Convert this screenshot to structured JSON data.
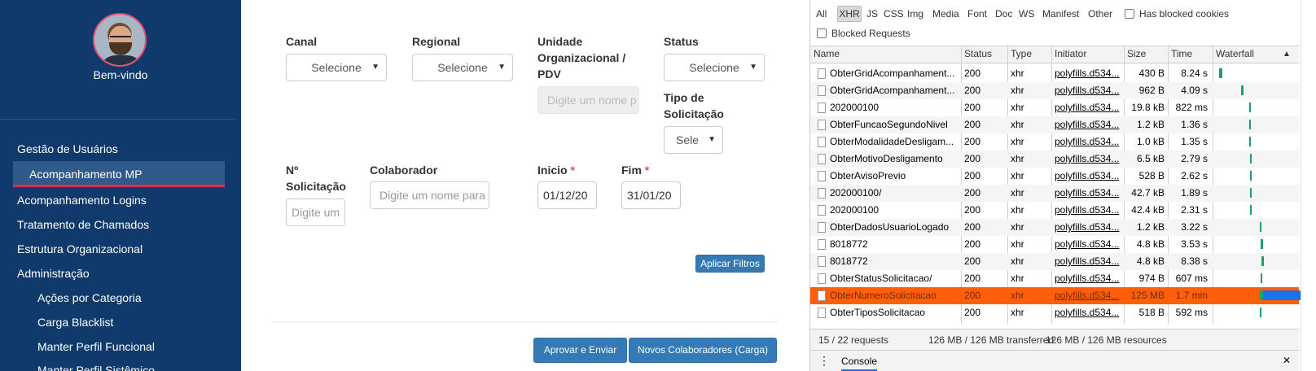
{
  "sidebar": {
    "welcome": "Bem-vindo",
    "items": [
      {
        "label": "Gestão de Usuários"
      },
      {
        "label": "Acompanhamento MP"
      },
      {
        "label": "Acompanhamento Logins"
      },
      {
        "label": "Tratamento de Chamados"
      },
      {
        "label": "Estrutura Organizacional"
      },
      {
        "label": "Administração"
      },
      {
        "label": "Ações por Categoria"
      },
      {
        "label": "Carga Blacklist"
      },
      {
        "label": "Manter Perfil Funcional"
      },
      {
        "label": "Manter Perfil Sistêmico"
      }
    ]
  },
  "filters": {
    "canal": {
      "label": "Canal",
      "value": "Selecione"
    },
    "regional": {
      "label": "Regional",
      "value": "Selecione"
    },
    "unidade": {
      "label_l1": "Unidade",
      "label_l2": "Organizacional /",
      "label_l3": "PDV",
      "placeholder": "Digite um nome p"
    },
    "status": {
      "label": "Status",
      "value": "Selecione"
    },
    "tipo": {
      "label_l1": "Tipo de",
      "label_l2": "Solicitação",
      "value": "Sele"
    },
    "numero": {
      "label_l1": "Nº",
      "label_l2": "Solicitação",
      "placeholder": "Digite um"
    },
    "colaborador": {
      "label": "Colaborador",
      "placeholder": "Digite um nome para bu"
    },
    "inicio": {
      "label": "Inicio",
      "required": "*",
      "value": "01/12/20"
    },
    "fim": {
      "label": "Fim",
      "required": "*",
      "value": "31/01/20"
    },
    "apply_button": "Aplicar Filtros"
  },
  "actions": {
    "approve": "Aprovar e Enviar",
    "new_collab": "Novos Colaboradores (Carga)"
  },
  "devtools": {
    "filters": [
      "All",
      "XHR",
      "JS",
      "CSS",
      "Img",
      "Media",
      "Font",
      "Doc",
      "WS",
      "Manifest",
      "Other"
    ],
    "has_blocked_cookies": "Has blocked cookies",
    "blocked_requests": "Blocked Requests",
    "columns": [
      "Name",
      "Status",
      "Type",
      "Initiator",
      "Size",
      "Time",
      "Waterfall"
    ],
    "sort_icon": "▲",
    "rows": [
      {
        "name": "ObterGridAcompanhament...",
        "status": "200",
        "type": "xhr",
        "initiator": "polyfills.d534...",
        "size": "430 B",
        "time": "8.24 s"
      },
      {
        "name": "ObterGridAcompanhament...",
        "status": "200",
        "type": "xhr",
        "initiator": "polyfills.d534...",
        "size": "962 B",
        "time": "4.09 s"
      },
      {
        "name": "202000100",
        "status": "200",
        "type": "xhr",
        "initiator": "polyfills.d534...",
        "size": "19.8 kB",
        "time": "822 ms"
      },
      {
        "name": "ObterFuncaoSegundoNivel",
        "status": "200",
        "type": "xhr",
        "initiator": "polyfills.d534...",
        "size": "1.2 kB",
        "time": "1.36 s"
      },
      {
        "name": "ObterModalidadeDesligam...",
        "status": "200",
        "type": "xhr",
        "initiator": "polyfills.d534...",
        "size": "1.0 kB",
        "time": "1.35 s"
      },
      {
        "name": "ObterMotivoDesligamento",
        "status": "200",
        "type": "xhr",
        "initiator": "polyfills.d534...",
        "size": "6.5 kB",
        "time": "2.79 s"
      },
      {
        "name": "ObterAvisoPrevio",
        "status": "200",
        "type": "xhr",
        "initiator": "polyfills.d534...",
        "size": "528 B",
        "time": "2.62 s"
      },
      {
        "name": "202000100/",
        "status": "200",
        "type": "xhr",
        "initiator": "polyfills.d534...",
        "size": "42.7 kB",
        "time": "1.89 s"
      },
      {
        "name": "202000100",
        "status": "200",
        "type": "xhr",
        "initiator": "polyfills.d534...",
        "size": "42.4 kB",
        "time": "2.31 s"
      },
      {
        "name": "ObterDadosUsuarioLogado",
        "status": "200",
        "type": "xhr",
        "initiator": "polyfills.d534...",
        "size": "1.2 kB",
        "time": "3.22 s"
      },
      {
        "name": "8018772",
        "status": "200",
        "type": "xhr",
        "initiator": "polyfills.d534...",
        "size": "4.8 kB",
        "time": "3.53 s"
      },
      {
        "name": "8018772",
        "status": "200",
        "type": "xhr",
        "initiator": "polyfills.d534...",
        "size": "4.8 kB",
        "time": "8.38 s"
      },
      {
        "name": "ObterStatusSolicitacao/",
        "status": "200",
        "type": "xhr",
        "initiator": "polyfills.d534...",
        "size": "974 B",
        "time": "607 ms"
      },
      {
        "name": "ObterNumeroSolicitacao",
        "status": "200",
        "type": "xhr",
        "initiator": "polyfills.d534...",
        "size": "125 MB",
        "time": "1.7 min"
      },
      {
        "name": "ObterTiposSolicitacao",
        "status": "200",
        "type": "xhr",
        "initiator": "polyfills.d534...",
        "size": "518 B",
        "time": "592 ms"
      }
    ],
    "summary": {
      "requests": "15 / 22 requests",
      "transferred": "126 MB / 126 MB transferred",
      "resources": "126 MB / 126 MB resources"
    },
    "drawer": {
      "menu_icon": "⋮",
      "tab": "Console",
      "close_icon": "✕"
    },
    "colors": {
      "selected_row": "#ff5f0a",
      "waterfall_green": "#1aa260",
      "waterfall_blue": "#1a73e8"
    }
  }
}
